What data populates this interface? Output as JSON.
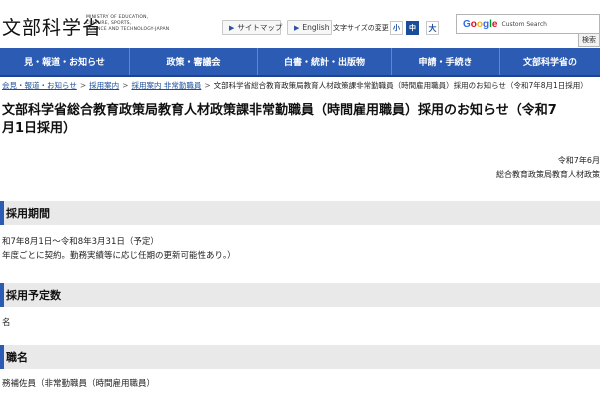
{
  "header": {
    "logo": "文部科学省",
    "logo_sub": "MINISTRY OF EDUCATION,\nCULTURE, SPORTS,\nSCIENCE AND TECHNOLOGY-JAPAN",
    "sitemap_label": "サイトマップ",
    "english_label": "English",
    "font_size_label": "文字サイズの変更",
    "font_small": "小",
    "font_mid": "中",
    "font_large": "大",
    "search_placeholder": "Custom Search",
    "search_button": "検索"
  },
  "nav": {
    "items": [
      {
        "label": "見・報道・お知らせ",
        "width": 130
      },
      {
        "label": "政策・審議会",
        "width": 128
      },
      {
        "label": "白書・統計・出版物",
        "width": 134
      },
      {
        "label": "申請・手続き",
        "width": 108
      },
      {
        "label": "文部科学省の",
        "width": 100
      }
    ]
  },
  "breadcrumb": {
    "items": [
      "会見・報道・お知らせ",
      "採用案内",
      "採用案内 非常勤職員"
    ],
    "current": "文部科学省総合教育政策局教育人材政策課非常勤職員（時間雇用職員）採用のお知らせ（令和7年8月1日採用）"
  },
  "main": {
    "title": "文部科学省総合教育政策局教育人材政策課非常勤職員（時間雇用職員）採用のお知らせ（令和7\n月1日採用）",
    "date": "令和7年6月",
    "dept": "総合教育政策局教育人材政策",
    "sections": [
      {
        "heading": "採用期間",
        "lines": [
          "和7年8月1日～令和8年3月31日（予定）",
          "年度ごとに契約。勤務実績等に応じ任期の更新可能性あり。）"
        ]
      },
      {
        "heading": "採用予定数",
        "lines": [
          "名"
        ]
      },
      {
        "heading": "職名",
        "lines": [
          "務補佐員（非常勤職員（時間雇用職員）"
        ]
      }
    ]
  },
  "colors": {
    "nav_bg": "#2c5bb4",
    "link": "#1a4d99",
    "section_bg": "#e9e9e9"
  }
}
